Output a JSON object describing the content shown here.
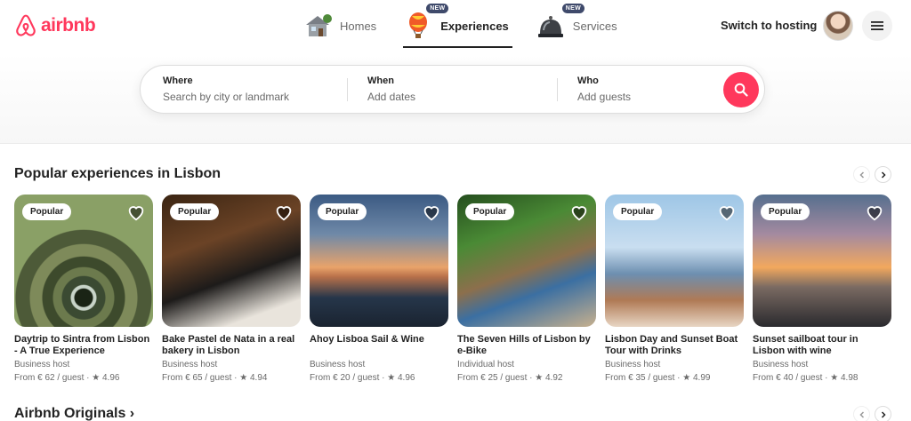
{
  "brand": {
    "name": "airbnb",
    "color": "#ff385c",
    "icon": "airbnb-logo-icon"
  },
  "nav": {
    "tabs": [
      {
        "label": "Homes",
        "icon": "house-icon",
        "badge": ""
      },
      {
        "label": "Experiences",
        "icon": "hot-air-balloon-icon",
        "badge": "NEW",
        "active": true
      },
      {
        "label": "Services",
        "icon": "service-bell-icon",
        "badge": "NEW"
      }
    ],
    "host_link": "Switch to hosting",
    "menu_icon": "hamburger-menu-icon"
  },
  "search": {
    "where_label": "Where",
    "where_placeholder": "Search by city or landmark",
    "when_label": "When",
    "when_placeholder": "Add dates",
    "who_label": "Who",
    "who_placeholder": "Add guests",
    "button_icon": "search-icon",
    "button_color": "#ff385c"
  },
  "section": {
    "title": "Popular experiences in Lisbon",
    "cards": [
      {
        "badge": "Popular",
        "title": "Daytrip to Sintra from Lisbon - A True Experience",
        "host": "Business host",
        "price": "From € 62 / guest · ★ 4.96"
      },
      {
        "badge": "Popular",
        "title": "Bake Pastel de Nata in a real bakery in Lisbon",
        "host": "Business host",
        "price": "From € 65 / guest · ★ 4.94"
      },
      {
        "badge": "Popular",
        "title": "Ahoy Lisboa Sail & Wine",
        "host": "Business host",
        "price": "From € 20 / guest · ★ 4.96"
      },
      {
        "badge": "Popular",
        "title": "The Seven Hills of Lisbon by e-Bike",
        "host": "Individual host",
        "price": "From € 25 / guest · ★ 4.92"
      },
      {
        "badge": "Popular",
        "title": "Lisbon Day and Sunset Boat Tour with Drinks",
        "host": "Business host",
        "price": "From € 35 / guest · ★ 4.99"
      },
      {
        "badge": "Popular",
        "title": "Sunset sailboat tour in Lisbon with wine",
        "host": "Business host",
        "price": "From € 40 / guest · ★ 4.98"
      }
    ]
  },
  "section2": {
    "title": "Airbnb Originals ›"
  }
}
